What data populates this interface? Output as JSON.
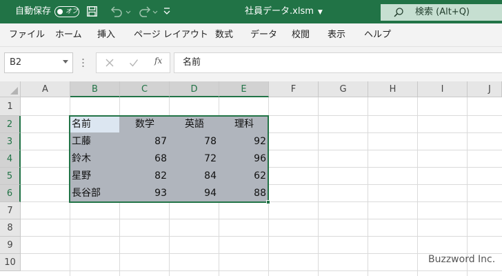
{
  "titlebar": {
    "autosave_label": "自動保存",
    "autosave_state": "オフ",
    "filename": "社員データ.xlsm",
    "search_label": "検索 (Alt+Q)"
  },
  "ribbon": {
    "tabs": [
      "ファイル",
      "ホーム",
      "挿入",
      "ページ レイアウト",
      "数式",
      "データ",
      "校閲",
      "表示",
      "ヘルプ"
    ]
  },
  "formula_bar": {
    "name_box": "B2",
    "fx_label": "fx",
    "value": "名前"
  },
  "grid": {
    "columns": [
      "A",
      "B",
      "C",
      "D",
      "E",
      "F",
      "G",
      "H",
      "I",
      "J"
    ],
    "rows": [
      "1",
      "2",
      "3",
      "4",
      "5",
      "6",
      "7",
      "8",
      "9",
      "10"
    ],
    "selected_columns": [
      "B",
      "C",
      "D",
      "E"
    ],
    "selected_rows": [
      "2",
      "3",
      "4",
      "5",
      "6"
    ],
    "table": {
      "headers": [
        "名前",
        "数学",
        "英語",
        "理科"
      ],
      "rows": [
        [
          "工藤",
          "87",
          "78",
          "92"
        ],
        [
          "鈴木",
          "68",
          "72",
          "96"
        ],
        [
          "星野",
          "82",
          "84",
          "62"
        ],
        [
          "長谷部",
          "93",
          "94",
          "88"
        ]
      ]
    }
  },
  "watermark": "Buzzword Inc.",
  "colors": {
    "brand": "#217346",
    "selection": "#b0b5bd",
    "active_cell": "#dce6f1"
  }
}
